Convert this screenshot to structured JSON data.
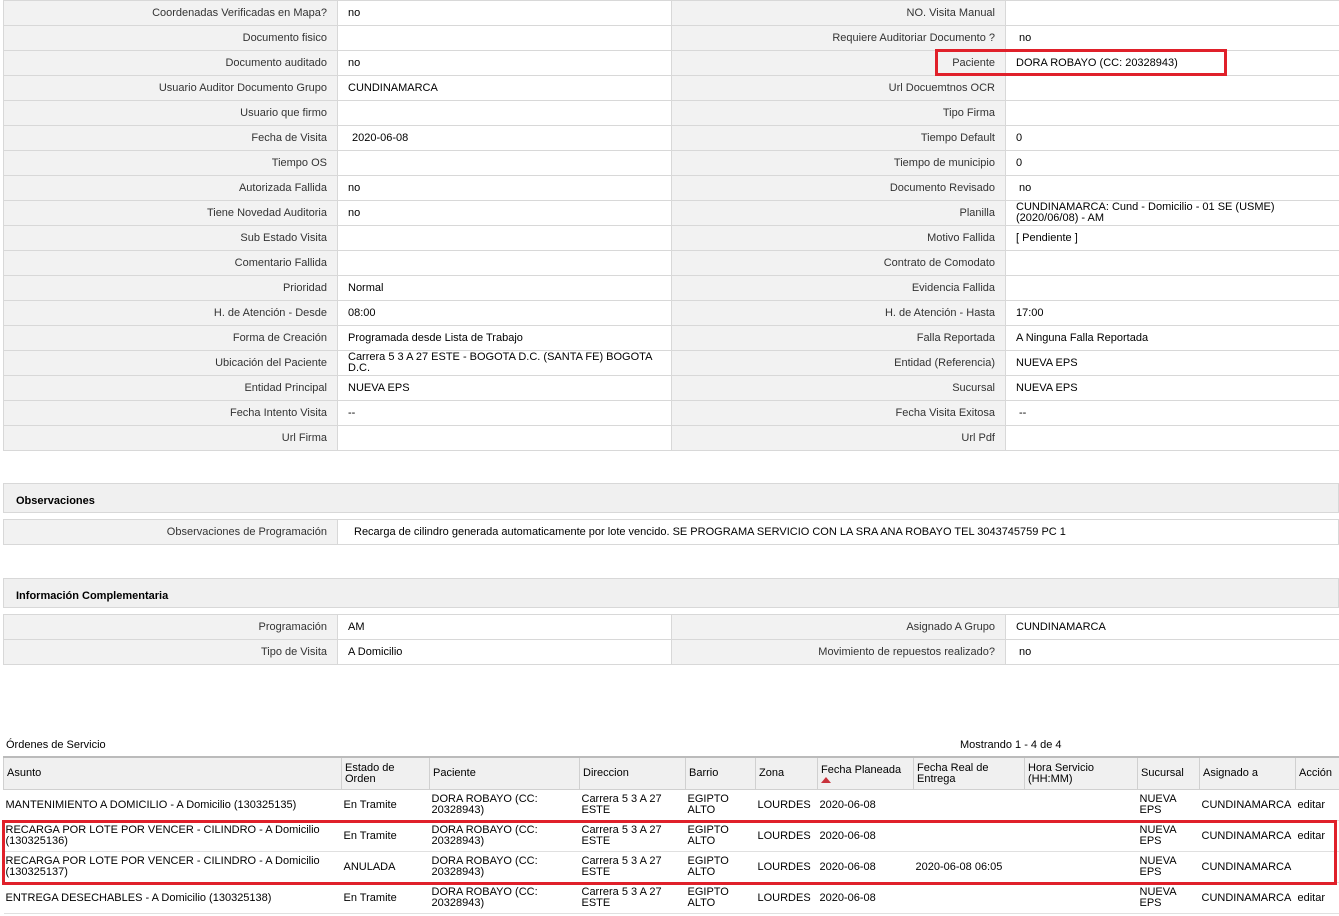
{
  "details": {
    "rows": [
      {
        "l1": "Coordenadas Verificadas en Mapa?",
        "v1": "no",
        "l2": "NO. Visita Manual",
        "v2": ""
      },
      {
        "l1": "Documento fisico",
        "v1": "",
        "l2": "Requiere Auditoriar Documento ?",
        "v2": "no"
      },
      {
        "l1": "Documento auditado",
        "v1": "no",
        "l2": "Paciente",
        "v2": "DORA ROBAYO (CC: 20328943)"
      },
      {
        "l1": "Usuario Auditor Documento Grupo",
        "v1": "CUNDINAMARCA",
        "l2": "Url Docuemtnos OCR",
        "v2": ""
      },
      {
        "l1": "Usuario que firmo",
        "v1": "",
        "l2": "Tipo Firma",
        "v2": ""
      },
      {
        "l1": "Fecha de Visita",
        "v1": "2020-06-08",
        "l2": "Tiempo Default",
        "v2": "0"
      },
      {
        "l1": "Tiempo OS",
        "v1": "",
        "l2": "Tiempo de municipio",
        "v2": "0"
      },
      {
        "l1": "Autorizada Fallida",
        "v1": "no",
        "l2": "Documento Revisado",
        "v2": "no"
      },
      {
        "l1": "Tiene Novedad Auditoria",
        "v1": "no",
        "l2": "Planilla",
        "v2": "CUNDINAMARCA: Cund - Domicilio - 01 SE (USME) (2020/06/08) - AM"
      },
      {
        "l1": "Sub Estado Visita",
        "v1": "",
        "l2": "Motivo Fallida",
        "v2": "[ Pendiente ]"
      },
      {
        "l1": "Comentario Fallida",
        "v1": "",
        "l2": "Contrato de Comodato",
        "v2": ""
      },
      {
        "l1": "Prioridad",
        "v1": "Normal",
        "l2": "Evidencia Fallida",
        "v2": ""
      },
      {
        "l1": "H. de Atención - Desde",
        "v1": "08:00",
        "l2": "H. de Atención - Hasta",
        "v2": "17:00"
      },
      {
        "l1": "Forma de Creación",
        "v1": "Programada desde Lista de Trabajo",
        "l2": "Falla Reportada",
        "v2": "A Ninguna Falla Reportada"
      },
      {
        "l1": "Ubicación del Paciente",
        "v1": "Carrera 5 3 A 27 ESTE - BOGOTA D.C. (SANTA FE) BOGOTA D.C.",
        "l2": "Entidad (Referencia)",
        "v2": "NUEVA EPS"
      },
      {
        "l1": "Entidad Principal",
        "v1": "NUEVA EPS",
        "l2": "Sucursal",
        "v2": "NUEVA EPS"
      },
      {
        "l1": "Fecha Intento Visita",
        "v1": "--",
        "l2": "Fecha Visita Exitosa",
        "v2": "--"
      },
      {
        "l1": "Url Firma",
        "v1": "",
        "l2": "Url Pdf",
        "v2": ""
      }
    ]
  },
  "observaciones": {
    "title": "Observaciones",
    "label": "Observaciones de Programación",
    "value": "Recarga de cilindro generada automaticamente por lote vencido. SE PROGRAMA SERVICIO CON LA SRA ANA ROBAYO TEL 3043745759 PC 1"
  },
  "complementaria": {
    "title": "Información Complementaria",
    "rows": [
      {
        "l1": "Programación",
        "v1": "AM",
        "l2": "Asignado A Grupo",
        "v2": "CUNDINAMARCA"
      },
      {
        "l1": "Tipo de Visita",
        "v1": "A Domicilio",
        "l2": "Movimiento de repuestos realizado?",
        "v2": "no"
      }
    ]
  },
  "orders": {
    "title": "Órdenes de Servicio",
    "count": "Mostrando 1 - 4 de 4",
    "headers": [
      "Asunto",
      "Estado de Orden",
      "Paciente",
      "Direccion",
      "Barrio",
      "Zona",
      "Fecha Planeada",
      "Fecha Real de Entrega",
      "Hora Servicio (HH:MM)",
      "Sucursal",
      "Asignado a",
      "Acción"
    ],
    "rows": [
      [
        "MANTENIMIENTO A DOMICILIO - A Domicilio (130325135)",
        "En Tramite",
        "DORA ROBAYO (CC: 20328943)",
        "Carrera 5 3 A 27 ESTE",
        "EGIPTO ALTO",
        "LOURDES",
        "2020-06-08",
        "",
        "",
        "NUEVA EPS",
        "CUNDINAMARCA",
        "editar"
      ],
      [
        "RECARGA POR LOTE POR VENCER - CILINDRO - A Domicilio (130325136)",
        "En Tramite",
        "DORA ROBAYO (CC: 20328943)",
        "Carrera 5 3 A 27 ESTE",
        "EGIPTO ALTO",
        "LOURDES",
        "2020-06-08",
        "",
        "",
        "NUEVA EPS",
        "CUNDINAMARCA",
        "editar"
      ],
      [
        "RECARGA POR LOTE POR VENCER - CILINDRO - A Domicilio (130325137)",
        "ANULADA",
        "DORA ROBAYO (CC: 20328943)",
        "Carrera 5 3 A 27 ESTE",
        "EGIPTO ALTO",
        "LOURDES",
        "2020-06-08",
        "2020-06-08 06:05",
        "",
        "NUEVA EPS",
        "CUNDINAMARCA",
        ""
      ],
      [
        "ENTREGA DESECHABLES - A Domicilio (130325138)",
        "En Tramite",
        "DORA ROBAYO (CC: 20328943)",
        "Carrera 5 3 A 27 ESTE",
        "EGIPTO ALTO",
        "LOURDES",
        "2020-06-08",
        "",
        "",
        "NUEVA EPS",
        "CUNDINAMARCA",
        "editar"
      ]
    ]
  },
  "colors": {
    "highlight": "#e0202a",
    "label_bg": "#f2f2f2",
    "header_bg": "#f0f0f0"
  }
}
